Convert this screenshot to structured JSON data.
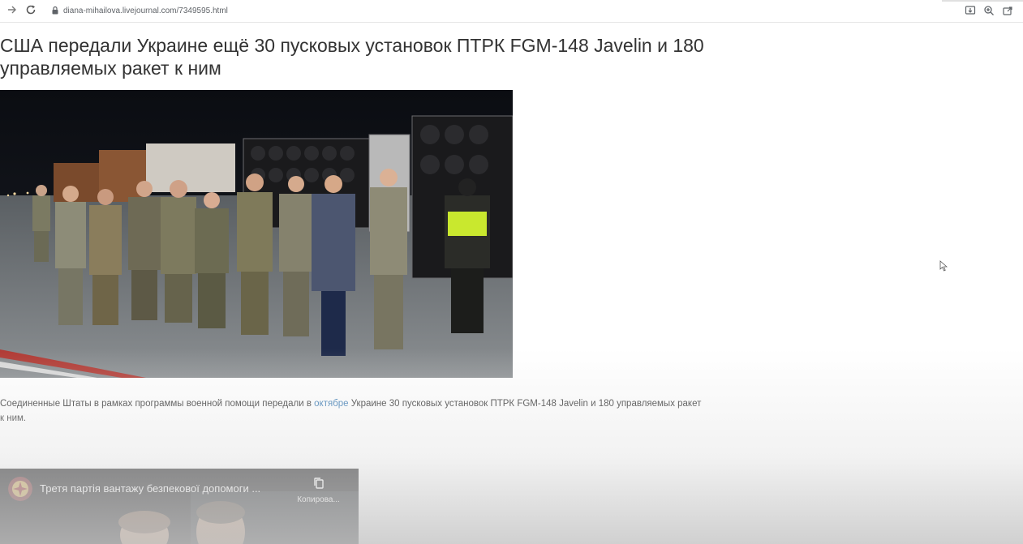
{
  "browser": {
    "url": "diana-mihailova.livejournal.com/7349595.html",
    "forward_icon": "arrow-right-icon",
    "reload_icon": "reload-icon",
    "lock_icon": "lock-icon",
    "right_icons": [
      "install-icon",
      "zoom-icon",
      "share-icon"
    ]
  },
  "article": {
    "title": "США передали Украине ещё 30 пусковых установок ПТРК FGM-148 Javelin и 180 управляемых ракет к ним",
    "body_before_link": "Соединенные Штаты в рамках программы военной помощи передали в ",
    "body_link": "октябре",
    "body_after_link": " Украине 30 пусковых установок ПТРК FGM-148 Javelin и 180 управляемых ракет к ним."
  },
  "video": {
    "title": "Третя партія вантажу безпекової допомоги ...",
    "copy_label": "Копирова..."
  },
  "colors": {
    "link": "#3a7ab3",
    "text": "#333333"
  }
}
